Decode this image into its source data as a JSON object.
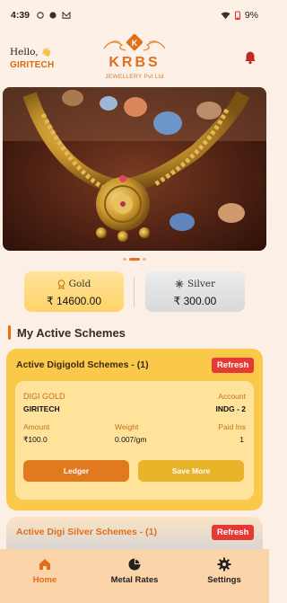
{
  "status_bar": {
    "time": "4:39",
    "battery": "9%"
  },
  "header": {
    "greeting": "Hello,",
    "greeting_emoji": "👋",
    "username": "GIRITECH"
  },
  "logo": {
    "brand": "KRBS",
    "subtitle": "JEWELLERY Pvt Ltd",
    "mark": "K"
  },
  "banner": {
    "slides": 3,
    "active_slide": 1
  },
  "rates": {
    "gold": {
      "label": "Gold",
      "value": "₹ 14600.00"
    },
    "silver": {
      "label": "Silver",
      "value": "₹ 300.00"
    }
  },
  "section_title": "My Active Schemes",
  "digigold_card": {
    "header": "Active Digigold Schemes - (1)",
    "refresh_label": "Refresh",
    "scheme_name": "DIGI GOLD",
    "account_label": "Account",
    "customer": "GIRITECH",
    "account_value": "INDG - 2",
    "amount_label": "Amount",
    "amount_value": "₹100.0",
    "weight_label": "Weight",
    "weight_value": "0.007/gm",
    "paid_label": "Paid Ins",
    "paid_value": "1",
    "ledger_label": "Ledger",
    "save_label": "Save More"
  },
  "digisilver_card": {
    "header": "Active Digi Silver Schemes - (1)",
    "refresh_label": "Refresh"
  },
  "nav": [
    {
      "label": "Home",
      "icon": "home-icon",
      "active": true
    },
    {
      "label": "Metal Rates",
      "icon": "pie-chart-icon",
      "active": false
    },
    {
      "label": "Settings",
      "icon": "gear-icon",
      "active": false
    }
  ],
  "colors": {
    "accent": "#e06f1b",
    "gold_card": "#fbc949",
    "refresh": "#e53935",
    "nav_bg": "#fcd4a9"
  }
}
